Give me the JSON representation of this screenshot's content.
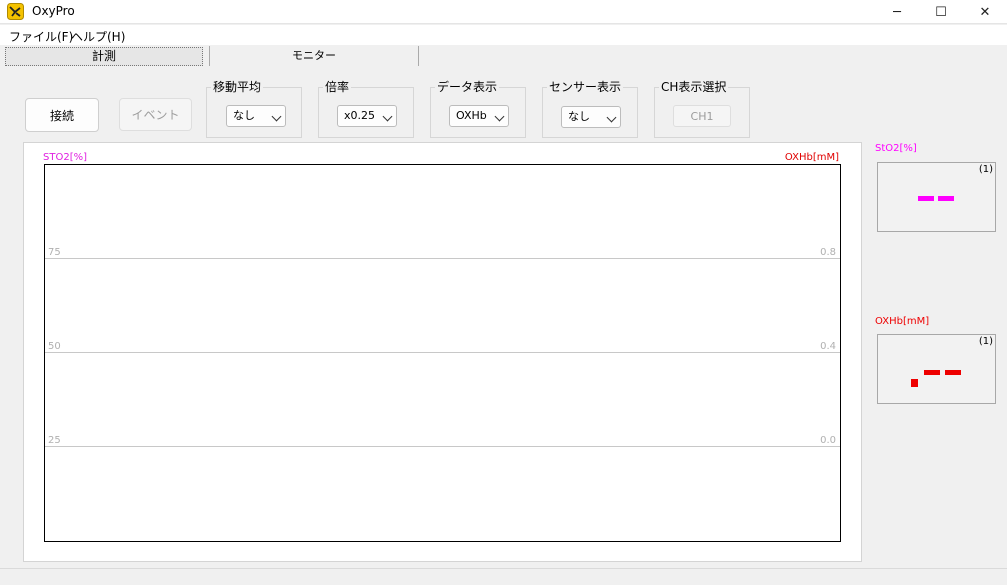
{
  "window": {
    "title": "OxyPro",
    "controls": {
      "minimize": "─",
      "maximize": "☐",
      "close": "✕"
    }
  },
  "menu": {
    "items": [
      "ファイル(F)",
      "ヘルプ(H)"
    ]
  },
  "tabs": [
    {
      "label": "計測",
      "active": true
    },
    {
      "label": "モニター",
      "active": false
    }
  ],
  "toolbar": {
    "connect_label": "接続",
    "event_label": "イベント",
    "moving_average": {
      "label": "移動平均",
      "value": "なし"
    },
    "magnification": {
      "label": "倍率",
      "value": "x0.25"
    },
    "data_display": {
      "label": "データ表示",
      "value": "OXHb"
    },
    "sensor_display": {
      "label": "センサー表示",
      "value": "なし"
    },
    "ch_select": {
      "label": "CH表示選択",
      "button": "CH1"
    }
  },
  "chart_data": {
    "type": "line",
    "left_axis": {
      "label": "STO2[%]",
      "ticks": [
        "75",
        "50",
        "25"
      ],
      "color": "#e020e0"
    },
    "right_axis": {
      "label": "OXHb[mM]",
      "ticks": [
        "0.8",
        "0.4",
        "0.0"
      ],
      "color": "#e00000"
    },
    "grid": true,
    "series": []
  },
  "monitors": [
    {
      "label": "StO2[%]",
      "channel": "(1)",
      "color": "#ff00ff"
    },
    {
      "label": "OXHb[mM]",
      "channel": "(1)",
      "color": "#ee0000"
    }
  ]
}
